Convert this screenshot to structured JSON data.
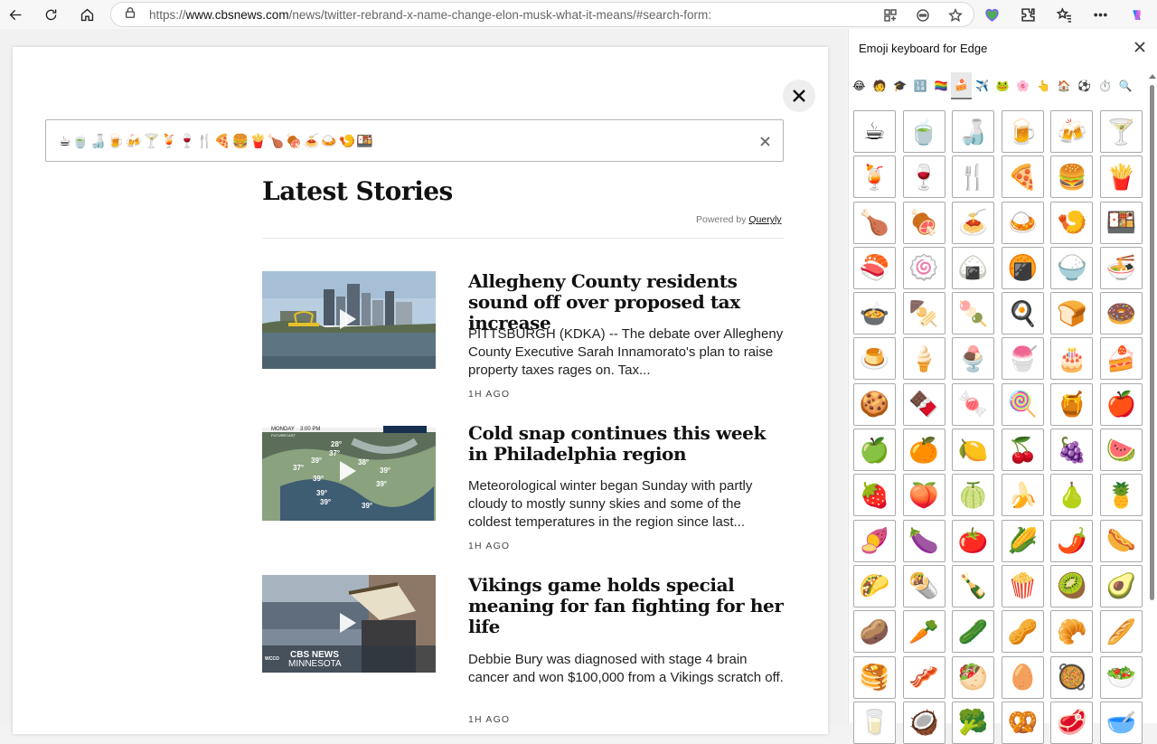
{
  "browser": {
    "url_prefix": "https://",
    "url_domain": "www.cbsnews.com",
    "url_path": "/news/twitter-rebrand-x-name-change-elon-musk-what-it-means/#search-form:"
  },
  "search": {
    "query": "☕🍵🍶🍺🍻🍸🍹🍷🍴🍕🍔🍟🍗🍖🍝🍛🍤🍱"
  },
  "results": {
    "heading": "Latest Stories",
    "powered_label": "Powered by",
    "powered_brand": "Queryly",
    "stories": [
      {
        "title": "Allegheny County residents sound off over proposed tax increase",
        "summary": "PITTSBURGH (KDKA) -- The debate over Allegheny County Executive Sarah Innamorato's plan to raise property taxes rages on. Tax...",
        "time": "1H AGO"
      },
      {
        "title": "Cold snap continues this week in Philadelphia region",
        "summary": "Meteorological winter began Sunday with partly cloudy to mostly sunny skies and some of the coldest temperatures in the region since last...",
        "time": "1H AGO",
        "thumb_text": {
          "day": "MONDAY",
          "time": "3:00 PM",
          "label": "FUTURECAST",
          "temps": [
            "28°",
            "37°",
            "39°",
            "37°",
            "39°",
            "39°",
            "39°",
            "39°",
            "39°",
            "39°",
            "38°"
          ]
        }
      },
      {
        "title": "Vikings game holds special meaning for fan fighting for her life",
        "summary": "Debbie Bury was diagnosed with stage 4 brain cancer and won $100,000 from a Vikings scratch off.",
        "time": "1H AGO",
        "thumb_text": {
          "station": "WCCO",
          "brand": "CBS NEWS",
          "region": "MINNESOTA"
        }
      }
    ]
  },
  "emoji_panel": {
    "title": "Emoji keyboard for Edge",
    "categories": [
      "😂",
      "🧑",
      "🎓",
      "🔢",
      "🏳️‍🌈",
      "🍰",
      "✈️",
      "🐸",
      "🌸",
      "👆",
      "🏠",
      "⚽",
      "⏱️",
      "🔍"
    ],
    "active_category": 5,
    "emojis": [
      "☕",
      "🍵",
      "🍶",
      "🍺",
      "🍻",
      "🍸",
      "🍹",
      "🍷",
      "🍴",
      "🍕",
      "🍔",
      "🍟",
      "🍗",
      "🍖",
      "🍝",
      "🍛",
      "🍤",
      "🍱",
      "🍣",
      "🍥",
      "🍙",
      "🍘",
      "🍚",
      "🍜",
      "🍲",
      "🍢",
      "🍡",
      "🍳",
      "🍞",
      "🍩",
      "🍮",
      "🍦",
      "🍨",
      "🍧",
      "🎂",
      "🍰",
      "🍪",
      "🍫",
      "🍬",
      "🍭",
      "🍯",
      "🍎",
      "🍏",
      "🍊",
      "🍋",
      "🍒",
      "🍇",
      "🍉",
      "🍓",
      "🍑",
      "🍈",
      "🍌",
      "🍐",
      "🍍",
      "🍠",
      "🍆",
      "🍅",
      "🌽",
      "🌶️",
      "🌭",
      "🌮",
      "🌯",
      "🍾",
      "🍿",
      "🥝",
      "🥑",
      "🥔",
      "🥕",
      "🥒",
      "🥜",
      "🥐",
      "🥖",
      "🥞",
      "🥓",
      "🥙",
      "🥚",
      "🥘",
      "🥗",
      "🥛",
      "🥥",
      "🥦",
      "🥨",
      "🥩",
      "🥣"
    ]
  }
}
